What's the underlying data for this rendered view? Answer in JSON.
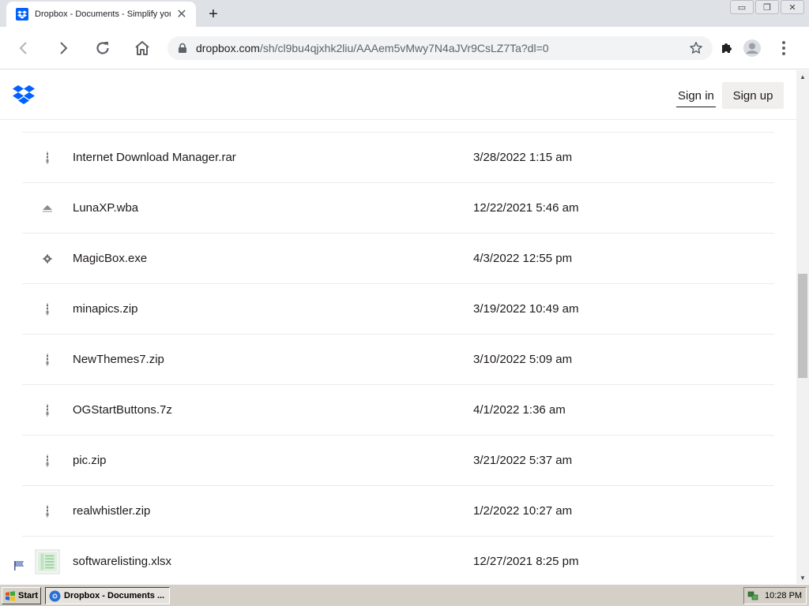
{
  "browser": {
    "tab_title": "Dropbox - Documents - Simplify your",
    "tab_close": "✕",
    "new_tab": "+",
    "window_controls": [
      "▭",
      "❐",
      "✕"
    ],
    "url_host": "dropbox.com",
    "url_path": "/sh/cl9bu4qjxhk2liu/AAAem5vMwy7N4aJVr9CsLZ7Ta?dl=0",
    "icons": {
      "back": "back-arrow-icon",
      "forward": "forward-arrow-icon",
      "reload": "reload-icon",
      "home": "home-icon",
      "lock": "lock-icon",
      "bookmark": "star-icon",
      "extensions": "puzzle-icon",
      "profile": "avatar-icon",
      "menu": "kebab-menu-icon"
    }
  },
  "header": {
    "sign_in": "Sign in",
    "sign_up": "Sign up",
    "brand_color": "#0061fe"
  },
  "files": [
    {
      "name": "Internet Download Manager.rar",
      "date": "3/28/2022 1:15 am",
      "icon": "archive-icon"
    },
    {
      "name": "LunaXP.wba",
      "date": "12/22/2021 5:46 am",
      "icon": "file-icon"
    },
    {
      "name": "MagicBox.exe",
      "date": "4/3/2022 12:55 pm",
      "icon": "gear-icon"
    },
    {
      "name": "minapics.zip",
      "date": "3/19/2022 10:49 am",
      "icon": "archive-icon"
    },
    {
      "name": "NewThemes7.zip",
      "date": "3/10/2022 5:09 am",
      "icon": "archive-icon"
    },
    {
      "name": "OGStartButtons.7z",
      "date": "4/1/2022 1:36 am",
      "icon": "archive-icon"
    },
    {
      "name": "pic.zip",
      "date": "3/21/2022 5:37 am",
      "icon": "archive-icon"
    },
    {
      "name": "realwhistler.zip",
      "date": "1/2/2022 10:27 am",
      "icon": "archive-icon"
    },
    {
      "name": "softwarelisting.xlsx",
      "date": "12/27/2021 8:25 pm",
      "icon": "spreadsheet-thumbnail-icon"
    }
  ],
  "taskbar": {
    "start_label": "Start",
    "window_label": "Dropbox - Documents ...",
    "clock": "10:28 PM"
  }
}
